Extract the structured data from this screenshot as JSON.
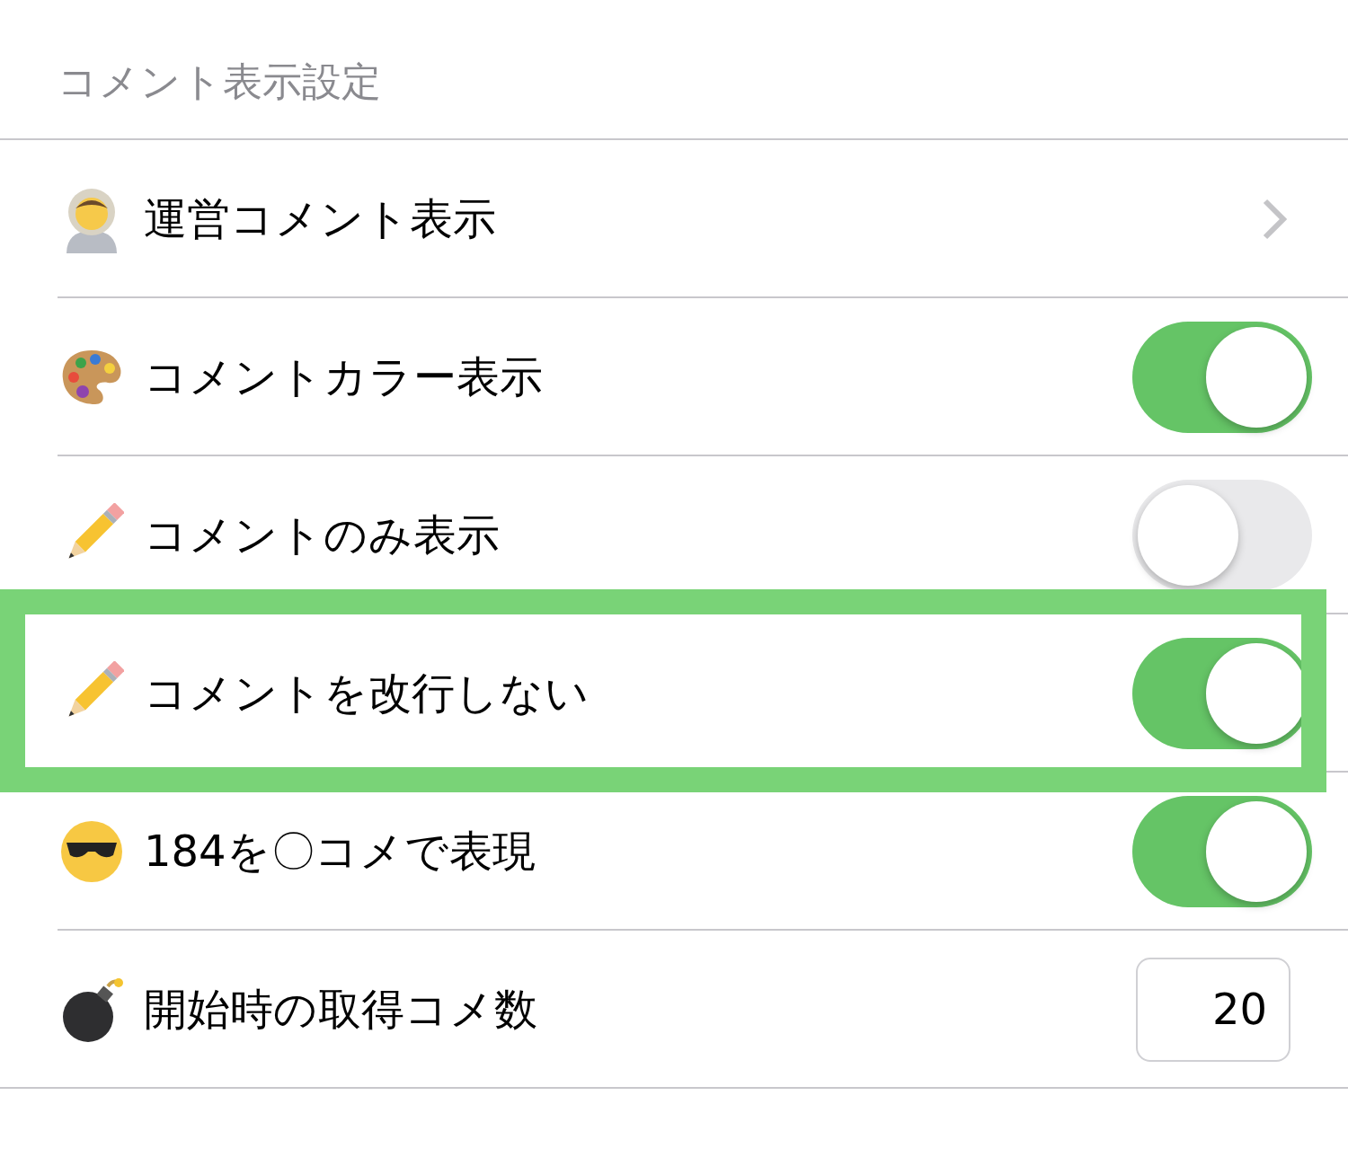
{
  "section_header": "コメント表示設定",
  "rows": [
    {
      "kind": "link",
      "label": "運営コメント表示",
      "highlighted": false
    },
    {
      "kind": "toggle",
      "label": "コメントカラー表示",
      "on": true,
      "highlighted": false
    },
    {
      "kind": "toggle",
      "label": "コメントのみ表示",
      "on": false,
      "highlighted": false
    },
    {
      "kind": "toggle",
      "label": "コメントを改行しない",
      "on": true,
      "highlighted": true
    },
    {
      "kind": "toggle",
      "label": "184を〇コメで表現",
      "on": true,
      "highlighted": false
    },
    {
      "kind": "number",
      "label": "開始時の取得コメ数",
      "value": "20",
      "highlighted": false
    }
  ]
}
